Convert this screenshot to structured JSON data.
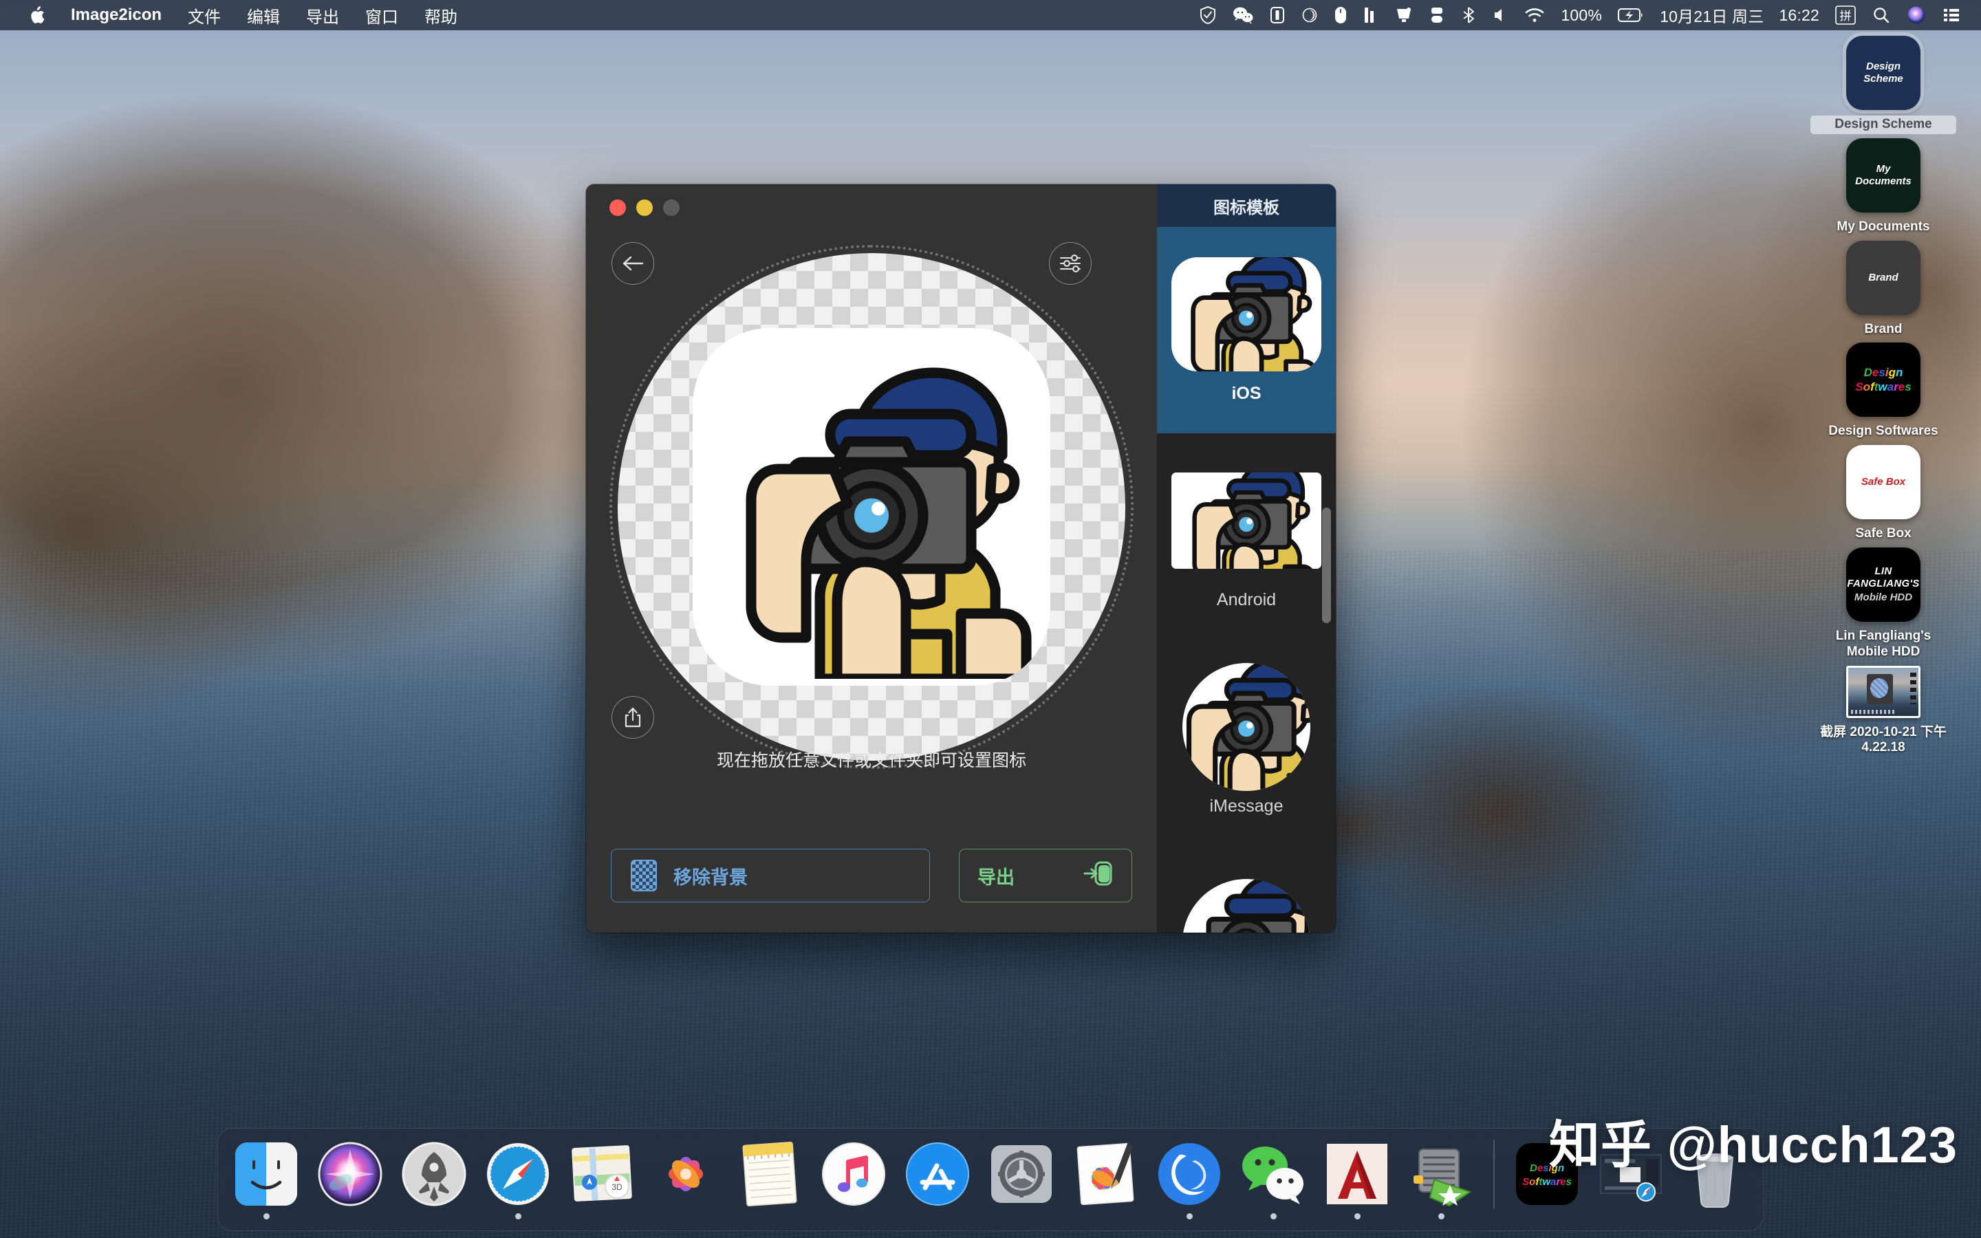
{
  "menubar": {
    "apple_icon": "apple-logo",
    "app_name": "Image2icon",
    "menus": [
      "文件",
      "编辑",
      "导出",
      "窗口",
      "帮助"
    ],
    "status_icons": [
      "shield-check-icon",
      "wechat-icon",
      "screen-mirror-icon",
      "moon-icon",
      "mouse-icon",
      "bars-icon",
      "display-icon",
      "dock-icon",
      "bluetooth-icon",
      "volume-icon",
      "wifi-icon"
    ],
    "battery_percent": "100%",
    "battery_icon": "battery-charging-icon",
    "date": "10月21日 周三",
    "time": "16:22",
    "input_method": "拼",
    "search_icon": "search-icon",
    "siri_icon": "siri-icon",
    "control_center_icon": "control-center-icon"
  },
  "desktop_icons": [
    {
      "label": "Design Scheme",
      "tile_text": "Design Scheme",
      "tile_class": "tile-design-scheme",
      "selected": true
    },
    {
      "label": "My Documents",
      "tile_text": "My Documents",
      "tile_class": "tile-my-documents",
      "selected": false
    },
    {
      "label": "Brand",
      "tile_text": "Brand",
      "tile_class": "tile-brand",
      "selected": false
    },
    {
      "label": "Design Softwares",
      "tile_text": "Design Softwares",
      "tile_class": "tile-design-softwares",
      "selected": false
    },
    {
      "label": "Safe Box",
      "tile_text": "Safe Box",
      "tile_class": "tile-safe-box",
      "selected": false
    },
    {
      "label": "Lin Fangliang's Mobile HDD",
      "tile_text": "LIN FANGLIANG'S",
      "tile_subtext": "Mobile HDD",
      "tile_class": "tile-hdd",
      "selected": false
    },
    {
      "label": "截屏 2020-10-21 下午 4.22.18",
      "tile_text": "",
      "tile_class": "tile-screenshot",
      "selected": false
    }
  ],
  "window": {
    "traffic_lights": [
      "close-button",
      "minimize-button",
      "zoom-button"
    ],
    "back_icon": "back-arrow-icon",
    "adjust_icon": "sliders-adjust-icon",
    "share_icon": "share-upload-icon",
    "preview_alt": "photographer-icon-preview",
    "drop_hint": "现在拖放任意文件或文件夹即可设置图标",
    "remove_bg_label": "移除背景",
    "remove_bg_icon": "checkerboard-icon",
    "export_label": "导出",
    "export_icon": "export-arrow-icon",
    "accent_blue": "#6ea5dd",
    "accent_green": "#7bd18a"
  },
  "sidebar": {
    "title": "图标模板",
    "title_bg": "#1c304a",
    "selected_bg": "#24587f",
    "templates": [
      {
        "name": "iOS",
        "shape": "rounded-square",
        "selected": true
      },
      {
        "name": "Android",
        "shape": "square",
        "selected": false
      },
      {
        "name": "iMessage",
        "shape": "circle",
        "selected": false
      },
      {
        "name": "",
        "shape": "circle",
        "selected": false
      }
    ]
  },
  "dock": {
    "items": [
      {
        "name": "Finder",
        "icon": "finder-icon",
        "running": true
      },
      {
        "name": "Siri",
        "icon": "siri-icon",
        "running": false
      },
      {
        "name": "Launchpad",
        "icon": "launchpad-icon",
        "running": false
      },
      {
        "name": "Safari",
        "icon": "safari-icon",
        "running": true
      },
      {
        "name": "Maps",
        "icon": "maps-icon",
        "running": false
      },
      {
        "name": "Photos",
        "icon": "photos-icon",
        "running": false
      },
      {
        "name": "Notes",
        "icon": "notes-icon",
        "running": false
      },
      {
        "name": "Music",
        "icon": "music-icon",
        "running": false
      },
      {
        "name": "App Store",
        "icon": "app-store-icon",
        "running": false
      },
      {
        "name": "System Preferences",
        "icon": "system-preferences-icon",
        "running": false
      },
      {
        "name": "Image Editor",
        "icon": "image-editor-icon",
        "running": false
      },
      {
        "name": "Browser",
        "icon": "browser-icon",
        "running": true
      },
      {
        "name": "WeChat",
        "icon": "wechat-icon",
        "running": true
      },
      {
        "name": "AutoCAD",
        "icon": "autocad-icon",
        "running": true
      },
      {
        "name": "Archiver",
        "icon": "archiver-icon",
        "running": true
      },
      {
        "name": "Design Softwares",
        "icon": "folder-design-softwares-icon",
        "running": false
      },
      {
        "name": "Screenshot File",
        "icon": "screenshot-file-icon",
        "running": false
      },
      {
        "name": "Trash",
        "icon": "trash-icon",
        "running": false
      }
    ]
  },
  "watermark": {
    "text": "知乎 @hucch123"
  }
}
